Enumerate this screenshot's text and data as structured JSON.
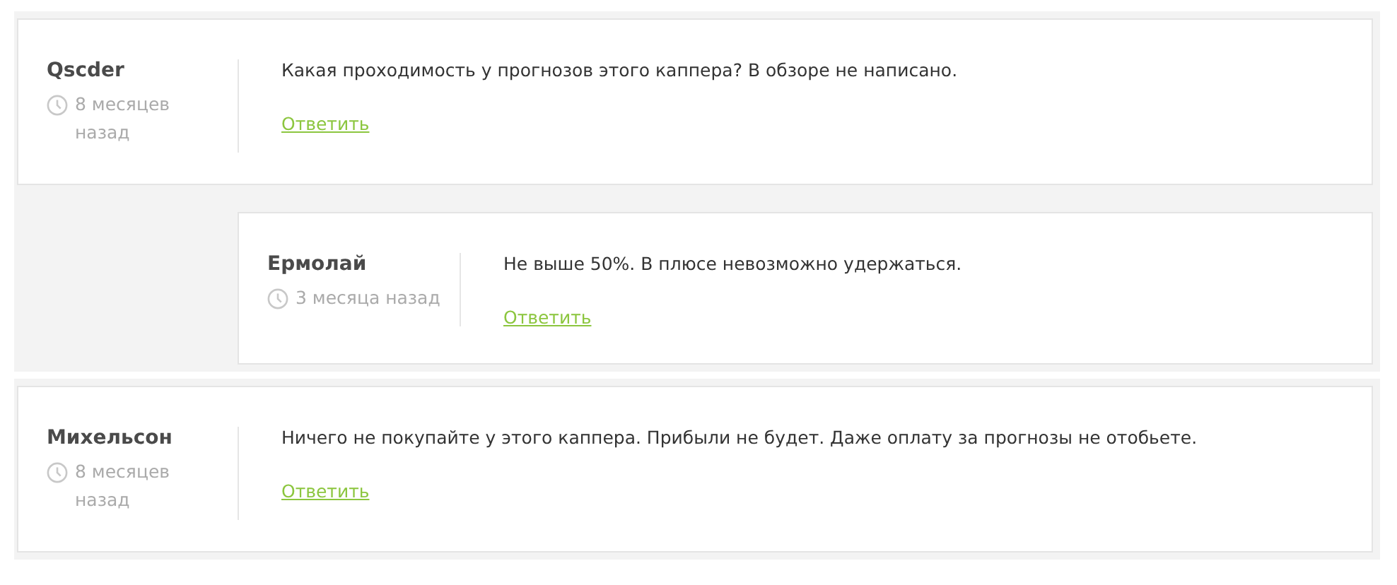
{
  "comments": [
    {
      "author": "Qscder",
      "time": "8 месяцев назад",
      "text": "Какая проходимость у прогнозов этого каппера? В обзоре не написано.",
      "reply_link": "Ответить",
      "replies": [
        {
          "author": "Ермолай",
          "time": "3 месяца назад",
          "text": "Не выше 50%. В плюсе невозможно удержаться.",
          "reply_link": "Ответить"
        }
      ]
    },
    {
      "author": "Михельсон",
      "time": "8 месяцев назад",
      "text": "Ничего не покупайте у этого каппера. Прибыли не будет. Даже оплату за прогнозы не отобьете.",
      "reply_link": "Ответить"
    }
  ]
}
